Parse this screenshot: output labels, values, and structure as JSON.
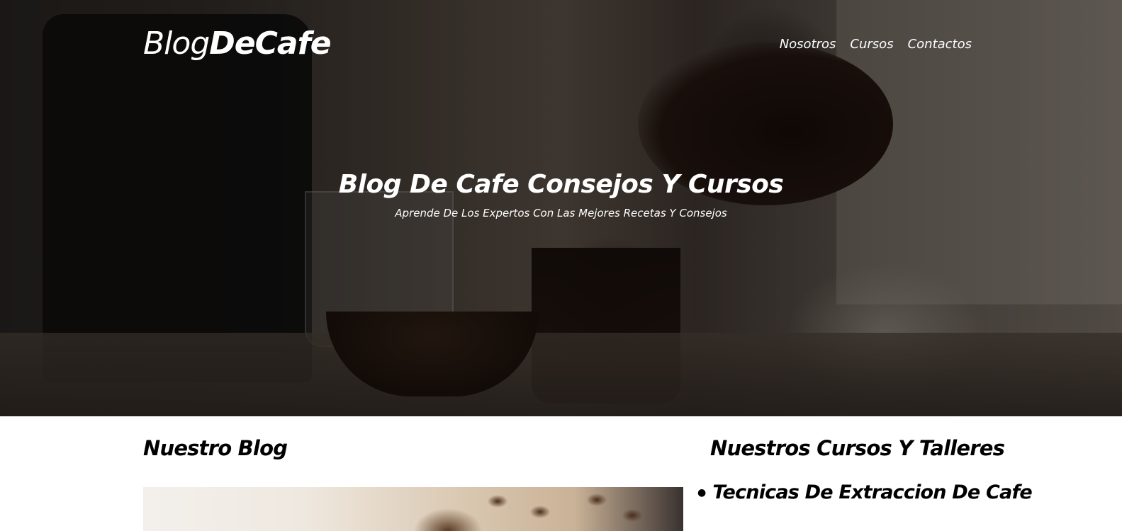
{
  "header": {
    "logo_light": "Blog",
    "logo_bold": "DeCafe",
    "nav": [
      {
        "label": "Nosotros"
      },
      {
        "label": "Cursos"
      },
      {
        "label": "Contactos"
      }
    ]
  },
  "hero": {
    "title": "Blog De Cafe Consejos Y Cursos",
    "subtitle": "Aprende De Los Expertos Con Las Mejores Recetas Y Consejos"
  },
  "blog": {
    "heading": "Nuestro Blog"
  },
  "courses": {
    "heading": "Nuestros Cursos Y Talleres",
    "items": [
      {
        "label": "Tecnicas De Extraccion De Cafe"
      }
    ]
  }
}
